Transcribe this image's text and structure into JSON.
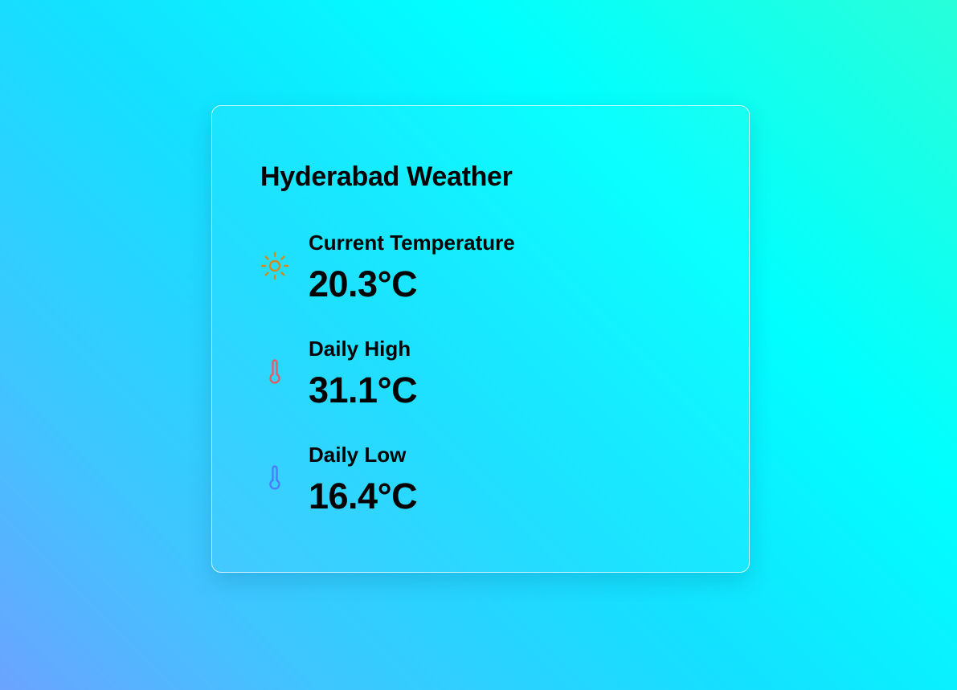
{
  "card": {
    "title": "Hyderabad Weather",
    "items": [
      {
        "label": "Current Temperature",
        "value": "20.3°C",
        "icon": "sun-icon",
        "icon_color": "#d28a1f"
      },
      {
        "label": "Daily High",
        "value": "31.1°C",
        "icon": "thermometer-icon",
        "icon_color": "#e85a63"
      },
      {
        "label": "Daily Low",
        "value": "16.4°C",
        "icon": "thermometer-icon",
        "icon_color": "#4a7dff"
      }
    ]
  }
}
